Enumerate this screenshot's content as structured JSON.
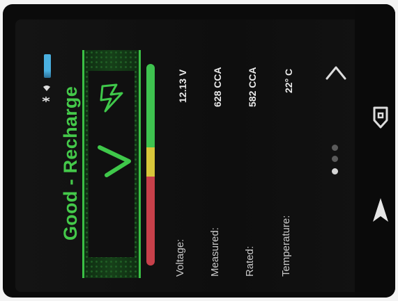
{
  "status": {
    "title": "Good - Recharge",
    "result_color": "#44c94a",
    "icons": [
      "battery-indicator",
      "wifi-icon",
      "bluetooth-icon"
    ]
  },
  "result": {
    "icons": [
      "check-icon",
      "lightning-icon"
    ]
  },
  "gauge": {
    "segments": [
      {
        "name": "good",
        "color": "#3ec34f"
      },
      {
        "name": "marginal",
        "color": "#d8c63a"
      },
      {
        "name": "bad",
        "color": "#c7404a"
      }
    ]
  },
  "readouts": [
    {
      "label": "Voltage:",
      "value": "12.13 V"
    },
    {
      "label": "Measured:",
      "value": "628 CCA"
    },
    {
      "label": "Rated:",
      "value": "582 CCA"
    },
    {
      "label": "Temperature:",
      "value": "22° C"
    }
  ],
  "pager": {
    "pages": 3,
    "active": 1
  },
  "nav": {
    "buttons": [
      "up-arrow-icon",
      "home-icon",
      "back-arrow-icon"
    ]
  }
}
